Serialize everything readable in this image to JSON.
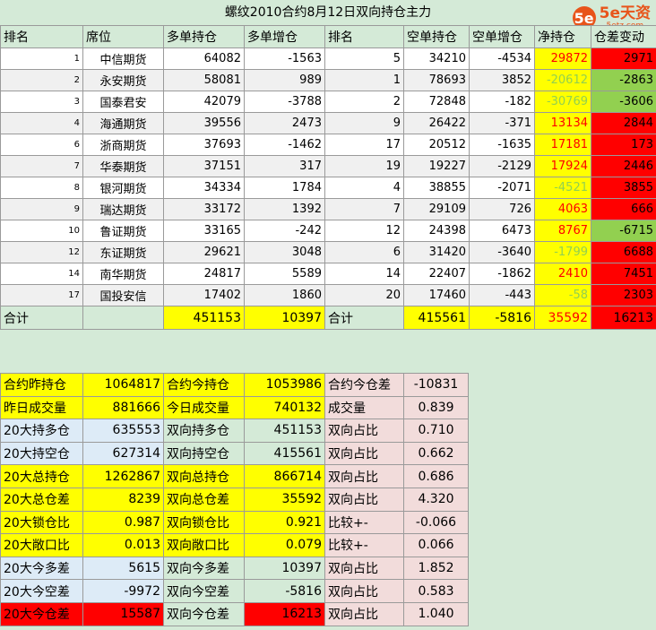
{
  "title": "螺纹2010合约8月12日双向持仓主力",
  "logo": {
    "mark": "5e",
    "brand": "5e天资",
    "url": "5etz.com"
  },
  "headers": [
    "排名",
    "席位",
    "多单持仓",
    "多单增仓",
    "排名",
    "空单持仓",
    "空单增仓",
    "净持仓",
    "仓差变动"
  ],
  "rows": [
    {
      "rank": "1",
      "name": "中信期货",
      "long": "64082",
      "long_chg": "-1563",
      "short_rank": "5",
      "short": "34210",
      "short_chg": "-4534",
      "net": "29872",
      "diff": "2971"
    },
    {
      "rank": "2",
      "name": "永安期货",
      "long": "58081",
      "long_chg": "989",
      "short_rank": "1",
      "short": "78693",
      "short_chg": "3852",
      "net": "-20612",
      "diff": "-2863"
    },
    {
      "rank": "3",
      "name": "国泰君安",
      "long": "42079",
      "long_chg": "-3788",
      "short_rank": "2",
      "short": "72848",
      "short_chg": "-182",
      "net": "-30769",
      "diff": "-3606"
    },
    {
      "rank": "4",
      "name": "海通期货",
      "long": "39556",
      "long_chg": "2473",
      "short_rank": "9",
      "short": "26422",
      "short_chg": "-371",
      "net": "13134",
      "diff": "2844"
    },
    {
      "rank": "6",
      "name": "浙商期货",
      "long": "37693",
      "long_chg": "-1462",
      "short_rank": "17",
      "short": "20512",
      "short_chg": "-1635",
      "net": "17181",
      "diff": "173"
    },
    {
      "rank": "7",
      "name": "华泰期货",
      "long": "37151",
      "long_chg": "317",
      "short_rank": "19",
      "short": "19227",
      "short_chg": "-2129",
      "net": "17924",
      "diff": "2446"
    },
    {
      "rank": "8",
      "name": "银河期货",
      "long": "34334",
      "long_chg": "1784",
      "short_rank": "4",
      "short": "38855",
      "short_chg": "-2071",
      "net": "-4521",
      "diff": "3855"
    },
    {
      "rank": "9",
      "name": "瑞达期货",
      "long": "33172",
      "long_chg": "1392",
      "short_rank": "7",
      "short": "29109",
      "short_chg": "726",
      "net": "4063",
      "diff": "666"
    },
    {
      "rank": "10",
      "name": "鲁证期货",
      "long": "33165",
      "long_chg": "-242",
      "short_rank": "12",
      "short": "24398",
      "short_chg": "6473",
      "net": "8767",
      "diff": "-6715"
    },
    {
      "rank": "12",
      "name": "东证期货",
      "long": "29621",
      "long_chg": "3048",
      "short_rank": "6",
      "short": "31420",
      "short_chg": "-3640",
      "net": "-1799",
      "diff": "6688"
    },
    {
      "rank": "14",
      "name": "南华期货",
      "long": "24817",
      "long_chg": "5589",
      "short_rank": "14",
      "short": "22407",
      "short_chg": "-1862",
      "net": "2410",
      "diff": "7451"
    },
    {
      "rank": "17",
      "name": "国投安信",
      "long": "17402",
      "long_chg": "1860",
      "short_rank": "20",
      "short": "17460",
      "short_chg": "-443",
      "net": "-58",
      "diff": "2303"
    }
  ],
  "total": {
    "label": "合计",
    "long": "451153",
    "long_chg": "10397",
    "label2": "合计",
    "short": "415561",
    "short_chg": "-5816",
    "net": "35592",
    "diff": "16213"
  },
  "summary": [
    [
      "合约昨持仓",
      "1064817",
      "合约今持仓",
      "1053986",
      "合约今仓差",
      "-10831"
    ],
    [
      "昨日成交量",
      "881666",
      "今日成交量",
      "740132",
      "成交量",
      "0.839"
    ],
    [
      "20大持多仓",
      "635553",
      "双向持多仓",
      "451153",
      "双向占比",
      "0.710"
    ],
    [
      "20大持空仓",
      "627314",
      "双向持空仓",
      "415561",
      "双向占比",
      "0.662"
    ],
    [
      "20大总持仓",
      "1262867",
      "双向总持仓",
      "866714",
      "双向占比",
      "0.686"
    ],
    [
      "20大总仓差",
      "8239",
      "双向总仓差",
      "35592",
      "双向占比",
      "4.320"
    ],
    [
      "20大锁仓比",
      "0.987",
      "双向锁仓比",
      "0.921",
      "比较+-",
      "-0.066"
    ],
    [
      "20大敞口比",
      "0.013",
      "双向敞口比",
      "0.079",
      "比较+-",
      "0.066"
    ],
    [
      "20大今多差",
      "5615",
      "双向今多差",
      "10397",
      "双向占比",
      "1.852"
    ],
    [
      "20大今空差",
      "-9972",
      "双向今空差",
      "-5816",
      "双向占比",
      "0.583"
    ],
    [
      "20大今仓差",
      "15587",
      "双向今仓差",
      "16213",
      "双向占比",
      "1.040"
    ]
  ],
  "colors": {
    "yellow": "#ffff00",
    "red": "#ff0000",
    "green": "#92d050",
    "bg": "#d4ead7"
  }
}
